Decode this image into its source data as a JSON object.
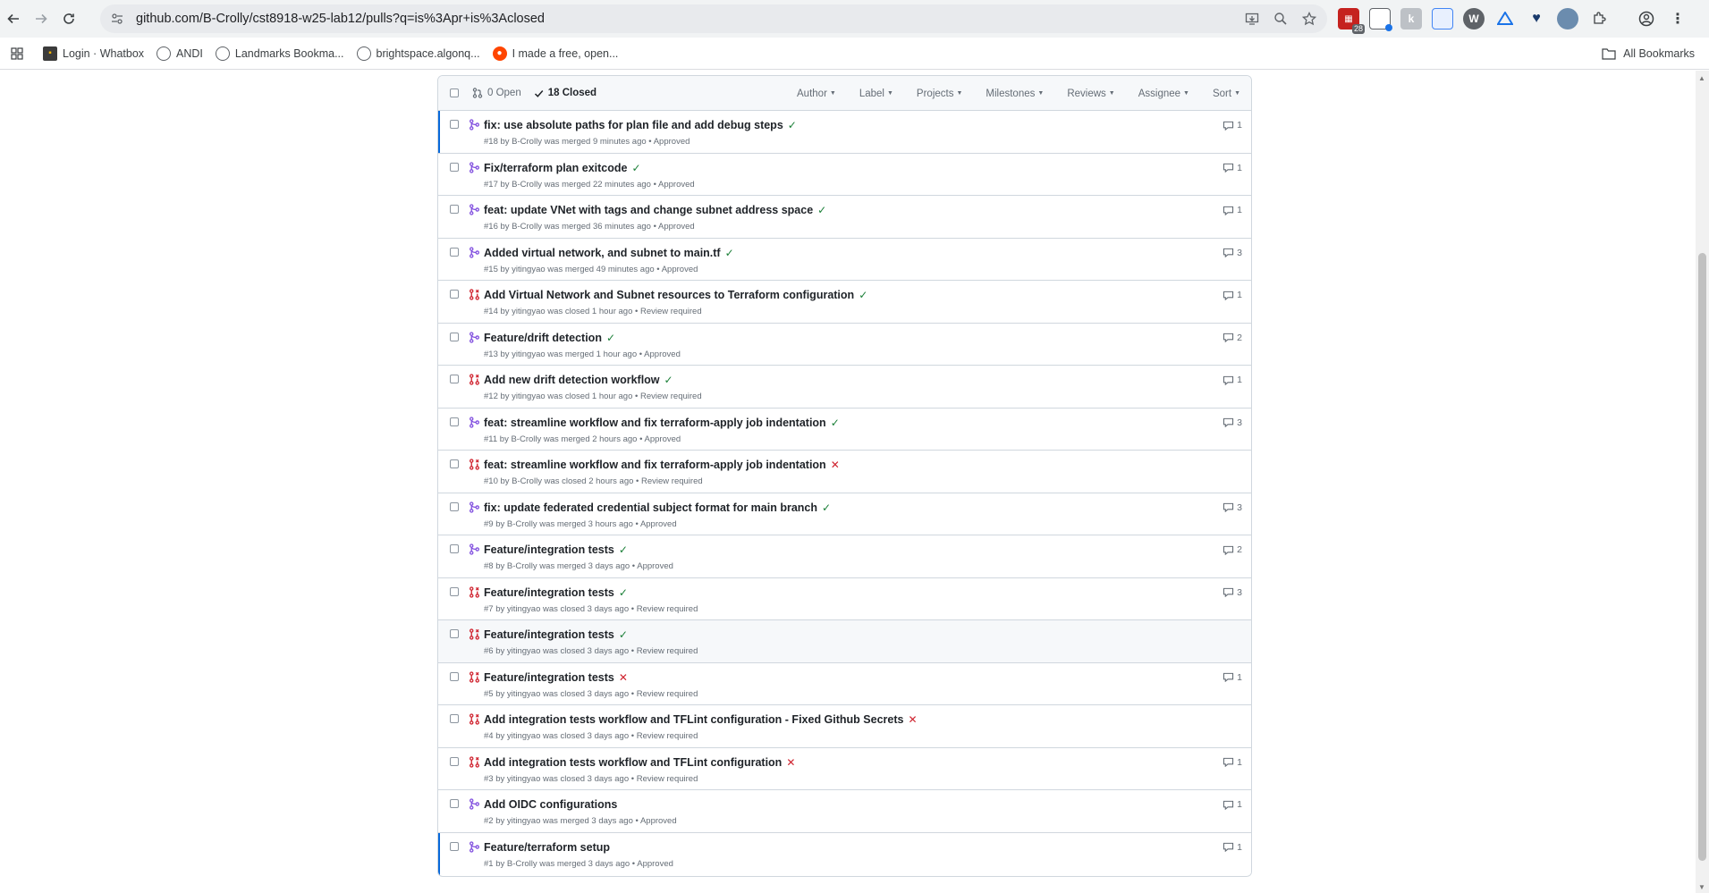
{
  "browser": {
    "url": "github.com/B-Crolly/cst8918-w25-lab12/pulls?q=is%3Apr+is%3Aclosed",
    "ext_badge": "28",
    "bookmarks": [
      {
        "label": "Login · Whatbox",
        "icon": "whatbox-icon",
        "color": "#3b3b3b"
      },
      {
        "label": "ANDI",
        "icon": "globe-icon",
        "color": "#5f6368"
      },
      {
        "label": "Landmarks Bookma...",
        "icon": "globe-icon",
        "color": "#5f6368"
      },
      {
        "label": "brightspace.algonq...",
        "icon": "globe-icon",
        "color": "#5f6368"
      },
      {
        "label": "I made a free, open...",
        "icon": "reddit-icon",
        "color": "#ff4500"
      }
    ],
    "all_bookmarks": "All Bookmarks"
  },
  "header": {
    "open_count": "0 Open",
    "closed_count": "18 Closed",
    "filters": [
      "Author",
      "Label",
      "Projects",
      "Milestones",
      "Reviews",
      "Assignee",
      "Sort"
    ]
  },
  "prs": [
    {
      "title": "fix: use absolute paths for plan file and add debug steps",
      "meta": "#18 by B-Crolly was merged 9 minutes ago • Approved",
      "state": "merged",
      "check": "ok",
      "comments": "1"
    },
    {
      "title": "Fix/terraform plan exitcode",
      "meta": "#17 by B-Crolly was merged 22 minutes ago • Approved",
      "state": "merged",
      "check": "ok",
      "comments": "1"
    },
    {
      "title": "feat: update VNet with tags and change subnet address space",
      "meta": "#16 by B-Crolly was merged 36 minutes ago • Approved",
      "state": "merged",
      "check": "ok",
      "comments": "1"
    },
    {
      "title": "Added virtual network, and subnet to main.tf",
      "meta": "#15 by yitingyao was merged 49 minutes ago • Approved",
      "state": "merged",
      "check": "ok",
      "comments": "3"
    },
    {
      "title": "Add Virtual Network and Subnet resources to Terraform configuration",
      "meta": "#14 by yitingyao was closed 1 hour ago • Review required",
      "state": "closed",
      "check": "ok",
      "comments": "1"
    },
    {
      "title": "Feature/drift detection",
      "meta": "#13 by yitingyao was merged 1 hour ago • Approved",
      "state": "merged",
      "check": "ok",
      "comments": "2"
    },
    {
      "title": "Add new drift detection workflow",
      "meta": "#12 by yitingyao was closed 1 hour ago • Review required",
      "state": "closed",
      "check": "ok",
      "comments": "1"
    },
    {
      "title": "feat: streamline workflow and fix terraform-apply job indentation",
      "meta": "#11 by B-Crolly was merged 2 hours ago • Approved",
      "state": "merged",
      "check": "ok",
      "comments": "3"
    },
    {
      "title": "feat: streamline workflow and fix terraform-apply job indentation",
      "meta": "#10 by B-Crolly was closed 2 hours ago • Review required",
      "state": "closed",
      "check": "fail",
      "comments": ""
    },
    {
      "title": "fix: update federated credential subject format for main branch",
      "meta": "#9 by B-Crolly was merged 3 hours ago • Approved",
      "state": "merged",
      "check": "ok",
      "comments": "3"
    },
    {
      "title": "Feature/integration tests",
      "meta": "#8 by B-Crolly was merged 3 days ago • Approved",
      "state": "merged",
      "check": "ok",
      "comments": "2"
    },
    {
      "title": "Feature/integration tests",
      "meta": "#7 by yitingyao was closed 3 days ago • Review required",
      "state": "closed",
      "check": "ok",
      "comments": "3"
    },
    {
      "title": "Feature/integration tests",
      "meta": "#6 by yitingyao was closed 3 days ago • Review required",
      "state": "closed",
      "check": "ok",
      "comments": ""
    },
    {
      "title": "Feature/integration tests",
      "meta": "#5 by yitingyao was closed 3 days ago • Review required",
      "state": "closed",
      "check": "fail",
      "comments": "1"
    },
    {
      "title": "Add integration tests workflow and TFLint configuration - Fixed Github Secrets",
      "meta": "#4 by yitingyao was closed 3 days ago • Review required",
      "state": "closed",
      "check": "fail",
      "comments": ""
    },
    {
      "title": "Add integration tests workflow and TFLint configuration",
      "meta": "#3 by yitingyao was closed 3 days ago • Review required",
      "state": "closed",
      "check": "fail",
      "comments": "1"
    },
    {
      "title": "Add OIDC configurations",
      "meta": "#2 by yitingyao was merged 3 days ago • Approved",
      "state": "merged",
      "check": "",
      "comments": "1"
    },
    {
      "title": "Feature/terraform setup",
      "meta": "#1 by B-Crolly was merged 3 days ago • Approved",
      "state": "merged",
      "check": "",
      "comments": "1"
    }
  ],
  "colors": {
    "merged": "#8250df",
    "closed": "#cf222e",
    "ok": "#1a7f37",
    "fail": "#cf222e"
  }
}
